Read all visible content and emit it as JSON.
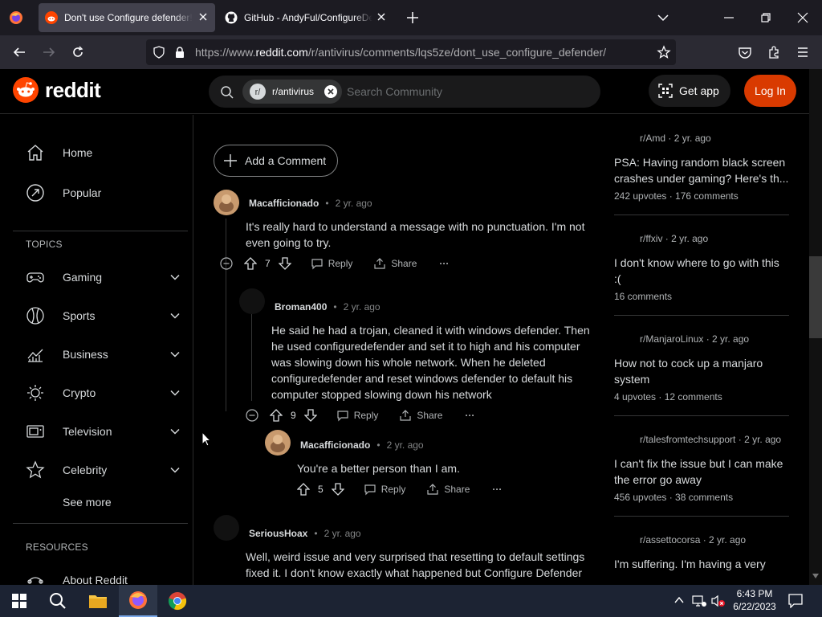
{
  "browser": {
    "tabs": [
      {
        "title": "Don't use Configure defender!!",
        "active": true,
        "icon": "reddit-icon"
      },
      {
        "title": "GitHub - AndyFul/ConfigureDefender",
        "active": false,
        "icon": "github-icon"
      }
    ],
    "url_prefix": "https://www.",
    "url_domain": "reddit.com",
    "url_path": "/r/antivirus/comments/lqs5ze/dont_use_configure_defender/"
  },
  "header": {
    "logo_text": "reddit",
    "search_chip": "r/antivirus",
    "search_placeholder": "Search Community",
    "get_app": "Get app",
    "login": "Log In",
    "colors": {
      "login_bg": "#d93a00",
      "brand": "#ff4500"
    }
  },
  "sidebar": {
    "top_items": [
      {
        "label": "Home",
        "icon": "home-icon"
      },
      {
        "label": "Popular",
        "icon": "popular-icon"
      }
    ],
    "topics_header": "TOPICS",
    "topics": [
      {
        "label": "Gaming",
        "icon": "gamepad-icon"
      },
      {
        "label": "Sports",
        "icon": "sports-icon"
      },
      {
        "label": "Business",
        "icon": "chart-icon"
      },
      {
        "label": "Crypto",
        "icon": "crypto-icon"
      },
      {
        "label": "Television",
        "icon": "tv-icon"
      },
      {
        "label": "Celebrity",
        "icon": "star-icon"
      }
    ],
    "see_more": "See more",
    "resources_header": "RESOURCES",
    "resources": [
      {
        "label": "About Reddit",
        "icon": "about-icon"
      }
    ]
  },
  "comments": {
    "add_comment": "Add a Comment",
    "reply_label": "Reply",
    "share_label": "Share",
    "items": [
      {
        "author": "Macafficionado",
        "age": "2 yr. ago",
        "body_lines": [
          "It's really hard to understand a message with no punctuation. I'm not",
          "even going to try."
        ],
        "score": "7"
      },
      {
        "author": "Broman400",
        "age": "2 yr. ago",
        "body_lines": [
          "He said he had a trojan, cleaned it with windows defender. Then",
          "he used configuredefender and set it to high and his computer",
          "was slowing down his whole network. When he deleted",
          "configuredefender and reset windows defender to default his",
          "computer stopped slowing down his network"
        ],
        "score": "9"
      },
      {
        "author": "Macafficionado",
        "age": "2 yr. ago",
        "body_lines": [
          "You're a better person than I am."
        ],
        "score": "5"
      },
      {
        "author": "SeriousHoax",
        "age": "2 yr. ago",
        "body_lines": [
          "Well, weird issue and very surprised that resetting to default settings",
          "fixed it. I don't know exactly what happened but Configure Defender"
        ],
        "score": ""
      }
    ]
  },
  "related": [
    {
      "sub": "r/Amd",
      "age": "2 yr. ago",
      "title_lines": [
        "PSA: Having random black screen",
        "crashes under gaming? Here's th..."
      ],
      "meta": "242 upvotes · 176 comments"
    },
    {
      "sub": "r/ffxiv",
      "age": "2 yr. ago",
      "title_lines": [
        "I don't know where to go with this",
        ":("
      ],
      "meta": "16 comments"
    },
    {
      "sub": "r/ManjaroLinux",
      "age": "2 yr. ago",
      "title_lines": [
        "How not to cock up a manjaro",
        "system"
      ],
      "meta": "4 upvotes · 12 comments"
    },
    {
      "sub": "r/talesfromtechsupport",
      "age": "2 yr. ago",
      "title_lines": [
        "I can't fix the issue but I can make",
        "the error go away"
      ],
      "meta": "456 upvotes · 38 comments"
    },
    {
      "sub": "r/assettocorsa",
      "age": "2 yr. ago",
      "title_lines": [
        "I'm suffering. I'm having a very"
      ],
      "meta": ""
    }
  ],
  "taskbar": {
    "time": "6:43 PM",
    "date": "6/22/2023"
  }
}
